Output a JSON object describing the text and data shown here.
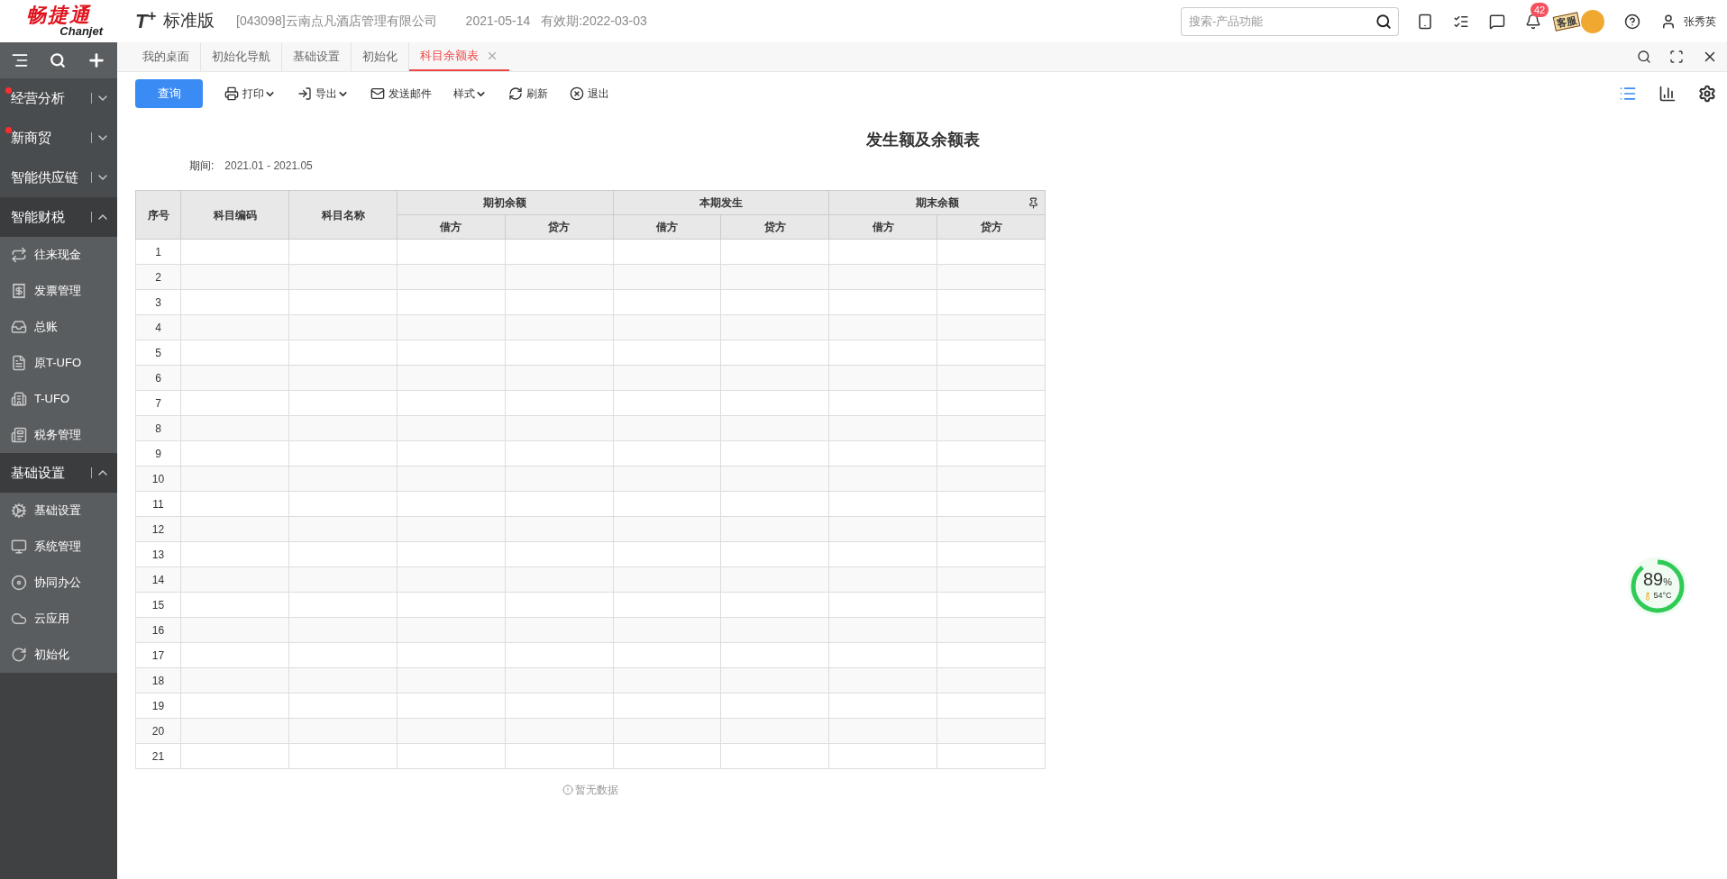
{
  "header": {
    "brand": "畅捷通",
    "brand_sub": "Chanjet",
    "product": "T$^{+}$",
    "edition": "标准版",
    "company": "[043098]云南点凡酒店管理有限公司",
    "date": "2021-05-14",
    "validity": "有效期:2022-03-03",
    "search": {
      "placeholder": "搜索-产品功能"
    },
    "notification_count": "42",
    "support_label": "客服",
    "user": "张秀英"
  },
  "sidebar": {
    "groups": [
      {
        "label": "经营分析",
        "notification": true,
        "expanded": false
      },
      {
        "label": "新商贸",
        "notification": true,
        "expanded": false
      },
      {
        "label": "智能供应链",
        "notification": false,
        "expanded": false
      },
      {
        "label": "智能财税",
        "notification": false,
        "expanded": true,
        "children": [
          {
            "label": "往来现金"
          },
          {
            "label": "发票管理"
          },
          {
            "label": "总账"
          },
          {
            "label": "原T-UFO"
          },
          {
            "label": "T-UFO"
          },
          {
            "label": "税务管理"
          }
        ]
      },
      {
        "label": "基础设置",
        "notification": false,
        "expanded": true,
        "children": [
          {
            "label": "基础设置"
          },
          {
            "label": "系统管理"
          },
          {
            "label": "协同办公"
          },
          {
            "label": "云应用"
          },
          {
            "label": "初始化"
          }
        ]
      }
    ]
  },
  "tabs": [
    {
      "label": "我的桌面",
      "selected": false,
      "closable": false
    },
    {
      "label": "初始化导航",
      "selected": false,
      "closable": false
    },
    {
      "label": "基础设置",
      "selected": false,
      "closable": false
    },
    {
      "label": "初始化",
      "selected": false,
      "closable": false
    },
    {
      "label": "科目余额表",
      "selected": true,
      "closable": true
    }
  ],
  "toolbar": [
    {
      "label": "查询",
      "kind": "primary"
    },
    {
      "label": "打印",
      "kind": "dropdown"
    },
    {
      "label": "导出",
      "kind": "dropdown"
    },
    {
      "label": "发送邮件",
      "kind": "plain"
    },
    {
      "label": "样式",
      "kind": "dropdown"
    },
    {
      "label": "刷新",
      "kind": "plain"
    },
    {
      "label": "退出",
      "kind": "plain"
    }
  ],
  "report": {
    "title": "发生额及余额表",
    "period_label": "期间:",
    "period": "2021.01 - 2021.05",
    "columns": [
      {
        "label": "序号"
      },
      {
        "label": "科目编码"
      },
      {
        "label": "科目名称"
      },
      {
        "label": "期初余额",
        "children": [
          "借方",
          "贷方"
        ]
      },
      {
        "label": "本期发生",
        "children": [
          "借方",
          "贷方"
        ]
      },
      {
        "label": "期末余额",
        "children": [
          "借方",
          "贷方"
        ]
      }
    ],
    "rows": [
      "1",
      "2",
      "3",
      "4",
      "5",
      "6",
      "7",
      "8",
      "9",
      "10",
      "11",
      "12",
      "13",
      "14",
      "15",
      "16",
      "17",
      "18",
      "19",
      "20",
      "21"
    ],
    "empty_text": "暂无数据"
  },
  "monitor": {
    "level": 0.89,
    "value": "89",
    "unit": "%",
    "temperature": "54°C"
  }
}
